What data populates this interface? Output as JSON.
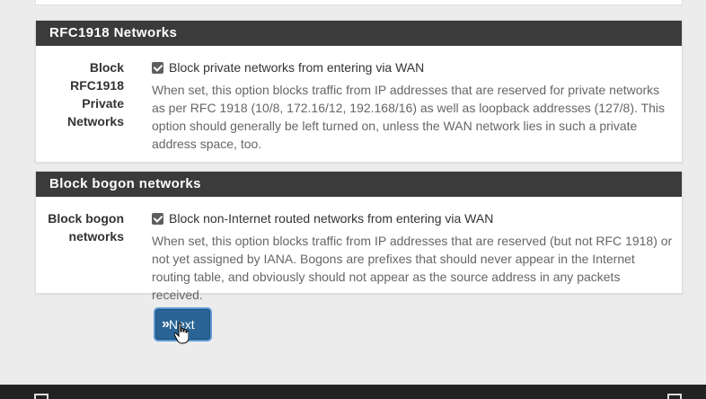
{
  "sections": [
    {
      "heading": "RFC1918 Networks",
      "label": "Block RFC1918 Private Networks",
      "label_lines": [
        "Block",
        "RFC1918",
        "Private",
        "Networks"
      ],
      "checkbox_label": "Block private networks from entering via WAN",
      "checked": true,
      "help": "When set, this option blocks traffic from IP addresses that are reserved for private networks as per RFC 1918 (10/8, 172.16/12, 192.168/16) as well as loopback addresses (127/8). This option should generally be left turned on, unless the WAN network lies in such a private address space, too."
    },
    {
      "heading": "Block bogon networks",
      "label": "Block bogon networks",
      "label_lines": [
        "Block bogon",
        "networks"
      ],
      "checkbox_label": "Block non-Internet routed networks from entering via WAN",
      "checked": true,
      "help": "When set, this option blocks traffic from IP addresses that are reserved (but not RFC 1918) or not yet assigned by IANA. Bogons are prefixes that should never appear in the Internet routing table, and obviously should not appear as the source address in any packets received."
    }
  ],
  "next_button": {
    "label": "Next",
    "icon": "double-chevron-right-icon"
  }
}
